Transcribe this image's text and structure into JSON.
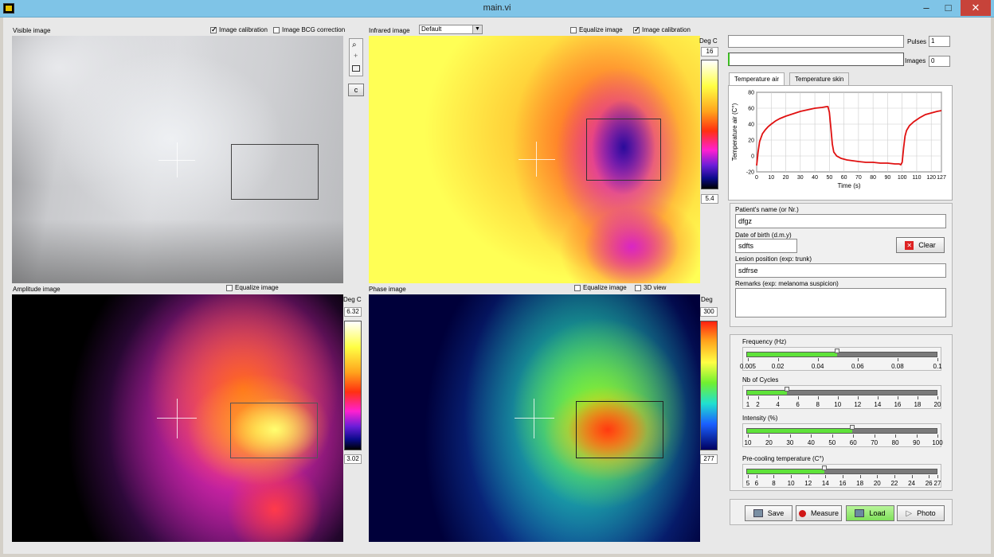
{
  "window": {
    "title": "main.vi"
  },
  "visible_panel": {
    "label": "Visible image",
    "image_calibration": {
      "label": "Image calibration",
      "checked": true
    },
    "bcg_correction": {
      "label": "Image BCG correction",
      "checked": false
    }
  },
  "tools": {
    "reset_label": "c"
  },
  "infrared_panel": {
    "label": "Infrared image",
    "palette_select": "Default",
    "equalize": {
      "label": "Equalize image",
      "checked": false
    },
    "image_calibration": {
      "label": "Image calibration",
      "checked": true
    },
    "unit": "Deg C",
    "scale_max": "16",
    "scale_min": "5.4"
  },
  "amplitude_panel": {
    "label": "Amplitude image",
    "equalize": {
      "label": "Equalize image",
      "checked": false
    },
    "unit": "Deg C",
    "scale_max": "6.32",
    "scale_min": "3.02"
  },
  "phase_panel": {
    "label": "Phase image",
    "equalize": {
      "label": "Equalize image",
      "checked": false
    },
    "view3d": {
      "label": "3D view",
      "checked": false
    },
    "unit": "Deg",
    "scale_max": "300",
    "scale_min": "277"
  },
  "status": {
    "pulses_label": "Pulses",
    "pulses_value": "1",
    "images_label": "Images",
    "images_value": "0"
  },
  "tabs": [
    {
      "label": "Temperature air",
      "active": true
    },
    {
      "label": "Temperature skin",
      "active": false
    }
  ],
  "chart_data": {
    "type": "line",
    "ylabel": "Temperature air (C°)",
    "xlabel": "Time (s)",
    "xlim": [
      0,
      127
    ],
    "ylim": [
      -20,
      80
    ],
    "xticks": [
      "0",
      "10",
      "20",
      "30",
      "40",
      "50",
      "60",
      "70",
      "80",
      "90",
      "100",
      "110",
      "120",
      "127"
    ],
    "yticks": [
      "80",
      "60",
      "40",
      "20",
      "0",
      "-20"
    ],
    "grid": true,
    "series": [
      {
        "color": "#e01010",
        "x": [
          0,
          1,
          2,
          4,
          6,
          8,
          10,
          13,
          16,
          20,
          25,
          30,
          35,
          40,
          45,
          48,
          49,
          50,
          51,
          52,
          53,
          55,
          58,
          62,
          66,
          70,
          75,
          80,
          85,
          90,
          95,
          98,
          99,
          100,
          101,
          102,
          103,
          105,
          108,
          112,
          116,
          120,
          124,
          127
        ],
        "y": [
          -12,
          5,
          18,
          28,
          33,
          37,
          40,
          44,
          47,
          50,
          53,
          56,
          58,
          60,
          61,
          62,
          62,
          55,
          35,
          15,
          5,
          0,
          -3,
          -5,
          -6,
          -7,
          -8,
          -8,
          -9,
          -9,
          -10,
          -10,
          -11,
          -8,
          10,
          25,
          32,
          38,
          43,
          48,
          52,
          54,
          56,
          57
        ]
      }
    ]
  },
  "patient": {
    "name_label": "Patient's name (or Nr.)",
    "name_value": "dfgz",
    "dob_label": "Date of birth (d.m.y)",
    "dob_value": "sdfts",
    "lesion_label": "Lesion position (exp: trunk)",
    "lesion_value": "sdfrse",
    "remarks_label": "Remarks (exp: melanoma suspicion)",
    "remarks_value": "",
    "clear_label": "Clear"
  },
  "sliders": [
    {
      "label": "Frequency (Hz)",
      "value": 0.05,
      "min": 0.005,
      "max": 0.1,
      "ticks": [
        0.005,
        0.02,
        0.04,
        0.06,
        0.08,
        0.1
      ],
      "tick_labels": [
        "0.005",
        "0.02",
        "0.04",
        "0.06",
        "0.08",
        "0.1"
      ]
    },
    {
      "label": "Nb of Cycles",
      "value": 5,
      "min": 1,
      "max": 20,
      "ticks": [
        1,
        2,
        4,
        6,
        8,
        10,
        12,
        14,
        16,
        18,
        20
      ],
      "tick_labels": [
        "1",
        "2",
        "4",
        "6",
        "8",
        "10",
        "12",
        "14",
        "16",
        "18",
        "20"
      ]
    },
    {
      "label": "Intensity (%)",
      "value": 60,
      "min": 10,
      "max": 100,
      "ticks": [
        10,
        20,
        30,
        40,
        50,
        60,
        70,
        80,
        90,
        100
      ],
      "tick_labels": [
        "10",
        "20",
        "30",
        "40",
        "50",
        "60",
        "70",
        "80",
        "90",
        "100"
      ]
    },
    {
      "label": "Pre-cooling temperature (C°)",
      "value": 14,
      "min": 5,
      "max": 27,
      "ticks": [
        5,
        6,
        8,
        10,
        12,
        14,
        16,
        18,
        20,
        22,
        24,
        26,
        27
      ],
      "tick_labels": [
        "5",
        "6",
        "8",
        "10",
        "12",
        "14",
        "16",
        "18",
        "20",
        "22",
        "24",
        "26",
        "27"
      ]
    }
  ],
  "actions": {
    "save": "Save",
    "measure": "Measure",
    "load": "Load",
    "photo": "Photo"
  }
}
